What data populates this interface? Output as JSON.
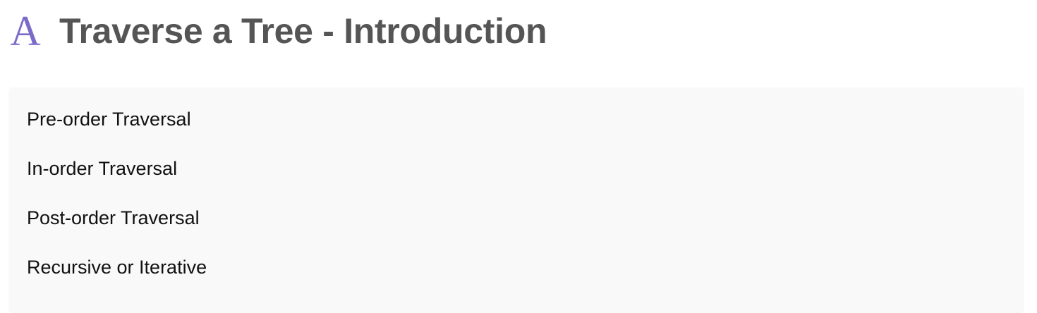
{
  "header": {
    "logo_icon": "letter-a-logo-icon",
    "logo_glyph": "A",
    "title": "Traverse a Tree - Introduction"
  },
  "toc": {
    "items": [
      {
        "label": "Pre-order Traversal"
      },
      {
        "label": "In-order Traversal"
      },
      {
        "label": "Post-order Traversal"
      },
      {
        "label": "Recursive or Iterative"
      }
    ]
  },
  "colors": {
    "logo": "#7b6bc9",
    "title": "#555555",
    "panel_background": "#f9f9f9",
    "item_text": "#111111"
  }
}
